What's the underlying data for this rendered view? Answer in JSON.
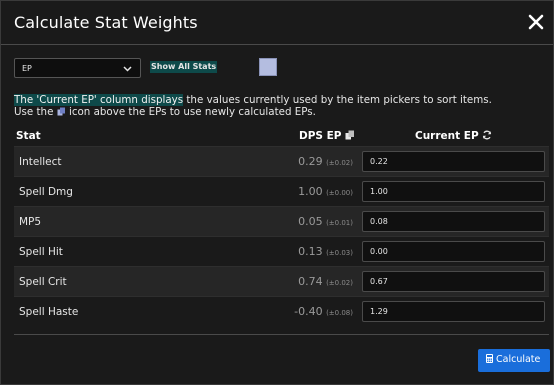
{
  "modal": {
    "title": "Calculate Stat Weights",
    "close_icon": "close-icon"
  },
  "controls": {
    "ep_select_value": "EP",
    "show_all_label": "Show All Stats",
    "swatch_color": "#b4bde0"
  },
  "info": {
    "highlight": "The 'Current EP' column displays",
    "line1_rest": " the values currently used by the item pickers to sort items.",
    "line2_pre": "Use the ",
    "line2_post": " icon above the EPs to use newly calculated EPs.",
    "icon": "copy-icon"
  },
  "table": {
    "headers": {
      "stat": "Stat",
      "dps": "DPS EP",
      "current": "Current EP"
    },
    "rows": [
      {
        "stat": "Intellect",
        "dps": "0.29",
        "err": "(±0.02)",
        "current": "0.22"
      },
      {
        "stat": "Spell Dmg",
        "dps": "1.00",
        "err": "(±0.00)",
        "current": "1.00"
      },
      {
        "stat": "MP5",
        "dps": "0.05",
        "err": "(±0.01)",
        "current": "0.08"
      },
      {
        "stat": "Spell Hit",
        "dps": "0.13",
        "err": "(±0.03)",
        "current": "0.00"
      },
      {
        "stat": "Spell Crit",
        "dps": "0.74",
        "err": "(±0.02)",
        "current": "0.67"
      },
      {
        "stat": "Spell Haste",
        "dps": "-0.40",
        "err": "(±0.08)",
        "current": "1.29"
      }
    ]
  },
  "footer": {
    "calculate_label": "Calculate",
    "accent": "#1a6edb"
  }
}
